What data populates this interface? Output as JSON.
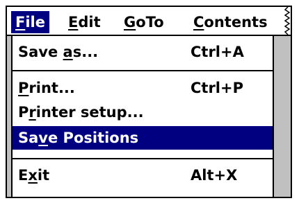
{
  "menubar": {
    "file": {
      "pre": "",
      "mn": "F",
      "post": "ile"
    },
    "edit": {
      "pre": "",
      "mn": "E",
      "post": "dit"
    },
    "goto": {
      "pre": "",
      "mn": "G",
      "post": "oTo"
    },
    "contents": {
      "pre": "",
      "mn": "C",
      "post": "ontents"
    }
  },
  "file_menu": {
    "save_as": {
      "pre": "Save ",
      "mn": "a",
      "post": "s...",
      "shortcut": "Ctrl+A"
    },
    "print": {
      "pre": "",
      "mn": "P",
      "post": "rint...",
      "shortcut": "Ctrl+P"
    },
    "printer_setup": {
      "pre": "P",
      "mn": "r",
      "post": "inter setup..."
    },
    "save_positions": {
      "pre": "Sa",
      "mn": "v",
      "post": "e Positions"
    },
    "exit": {
      "pre": "E",
      "mn": "x",
      "post": "it",
      "shortcut": "Alt+X"
    }
  },
  "colors": {
    "highlight": "#000080",
    "menu_background": "#ffffff",
    "window_background": "#c0c0c0"
  }
}
